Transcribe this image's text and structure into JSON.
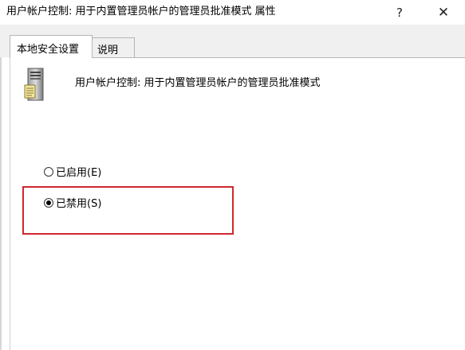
{
  "window": {
    "title": "用户帐户控制: 用于内置管理员帐户的管理员批准模式 属性",
    "help_glyph": "?",
    "close_glyph": "✕"
  },
  "tabs": [
    {
      "label": "本地安全设置",
      "active": true
    },
    {
      "label": "说明",
      "active": false
    }
  ],
  "policy": {
    "icon": "server-icon",
    "name": "用户帐户控制: 用于内置管理员帐户的管理员批准模式"
  },
  "options": [
    {
      "label": "已启用(E)",
      "selected": false
    },
    {
      "label": "已禁用(S)",
      "selected": true
    }
  ],
  "annotation": {
    "color": "#d0282f"
  }
}
